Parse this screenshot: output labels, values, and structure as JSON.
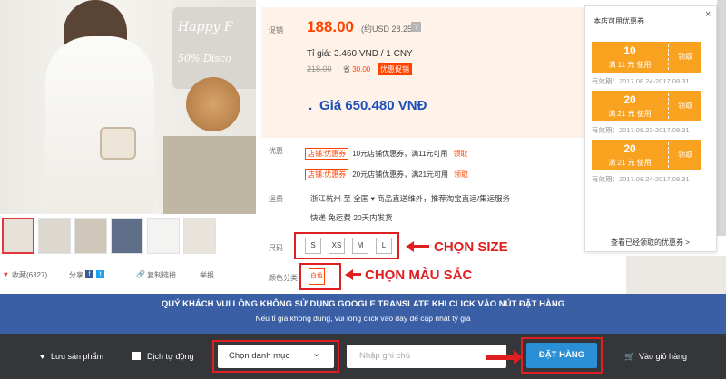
{
  "gallery": {
    "sign_lines": [
      "Happy F",
      "50% Disco"
    ]
  },
  "actions": {
    "favorites": "收藏(6327)",
    "share": "分享",
    "copy_link": "复制链接",
    "report": "举报"
  },
  "price": {
    "label": "促销",
    "value": "188.00",
    "usd": "(约USD 28.25",
    "help_icon": "question-icon",
    "exchange_rate": "Tỉ giá: 3.460 VNĐ / 1 CNY",
    "old_price": "218.00",
    "save_prefix": "省",
    "save_amount": "30.00",
    "promo_tag": "优惠促销",
    "vnd": "Giá 650.480 VNĐ"
  },
  "discounts": {
    "label": "优惠",
    "lines": [
      {
        "tag": "店铺:优惠券",
        "text": "10元店铺优惠券，满11元可用",
        "action": "领取"
      },
      {
        "tag": "店铺:优惠券",
        "text": "20元店铺优惠券，满21元可用",
        "action": "领取"
      }
    ]
  },
  "shipping": {
    "label": "运费",
    "line1": "浙江杭州 至  全国 ▾   商品直送维外，推荐淘宝直运/集运服务",
    "line2": "快递 免运费      20天内发货"
  },
  "sizes": {
    "label": "尺码",
    "options": [
      "S",
      "XS",
      "M",
      "L"
    ],
    "annotation": "CHỌN SIZE"
  },
  "colors": {
    "label": "颜色分类",
    "options": [
      "白色"
    ],
    "annotation": "CHỌN MÀU SẮC"
  },
  "coupon_popup": {
    "title": "本店可用优惠券",
    "close": "×",
    "coupons": [
      {
        "amount": "10",
        "condition": "满 11 元 使用",
        "action": "领取",
        "valid": "有效期：2017.08.24-2017.08.31"
      },
      {
        "amount": "20",
        "condition": "满 21 元 使用",
        "action": "领取",
        "valid": "有效期：2017.08.23-2017.08.31"
      },
      {
        "amount": "20",
        "condition": "满 21 元 使用",
        "action": "领取",
        "valid": "有效期：2017.08.24-2017.08.31"
      }
    ],
    "link": "查看已经领取的优惠券 >"
  },
  "notice": {
    "line1": "QUÝ KHÁCH VUI LÒNG KHÔNG SỬ DỤNG GOOGLE TRANSLATE KHI CLICK VÀO NÚT ĐẶT HÀNG",
    "line2": "Nếu tỉ giá không đúng, vui lòng click vào đây để cập nhật tỷ giá"
  },
  "bottom_bar": {
    "save_product": "Lưu sản phẩm",
    "auto_translate": "Dịch tự động",
    "category_select": "Chọn danh mục",
    "note_placeholder": "Nhập ghi chú",
    "order_button": "ĐẶT HÀNG",
    "cart": "Vào giỏ hàng"
  }
}
